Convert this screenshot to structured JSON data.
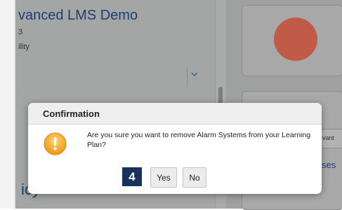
{
  "background": {
    "title_partial": "vanced LMS Demo",
    "subtitle_number": "3",
    "subtitle_text": "ility",
    "bottom_text_partial": "icy",
    "right_field_text": "vant",
    "right_link_text": "ses"
  },
  "dialog": {
    "title": "Confirmation",
    "message": "Are you sure you want to remove Alarm Systems from your Learning Plan?",
    "step_badge": "4",
    "yes_label": "Yes",
    "no_label": "No"
  },
  "colors": {
    "accent_red_circle": "#c25a48",
    "warning_orange": "#f0a21d",
    "badge_navy": "#17325c",
    "title_blue": "#1f3f73"
  },
  "icons": {
    "dropdown": "chevron-down-icon",
    "warning": "warning-icon"
  }
}
